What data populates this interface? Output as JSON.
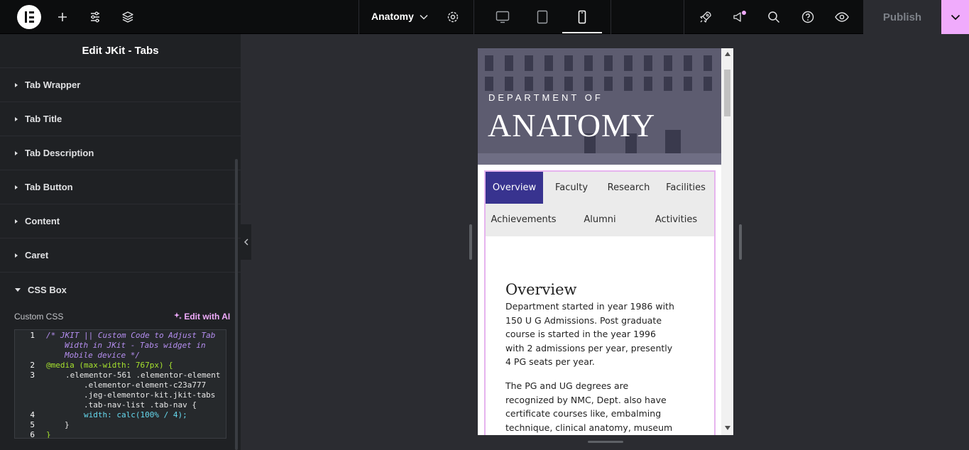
{
  "topbar": {
    "document_title": "Anatomy",
    "publish_label": "Publish",
    "icons": [
      "elementor-logo-icon",
      "add-icon",
      "site-settings-icon",
      "structure-icon",
      "chevron-down-icon",
      "page-settings-icon",
      "desktop-icon",
      "tablet-icon",
      "mobile-icon",
      "rocket-icon",
      "whats-new-icon",
      "search-icon",
      "help-icon",
      "preview-icon"
    ],
    "accent_color": "#f0abfc"
  },
  "panel": {
    "title": "Edit JKit - Tabs",
    "sections": [
      "Tab Wrapper",
      "Tab Title",
      "Tab Description",
      "Tab Button",
      "Content",
      "Caret",
      "CSS Box"
    ],
    "custom_css_label": "Custom CSS",
    "edit_with_ai": "Edit with AI",
    "code_lines": {
      "n1": "1",
      "n2": "2",
      "n3": "3",
      "n4": "4",
      "n5": "5",
      "n6": "6",
      "l1a": "/* JKIT || Custom Code to Adjust Tab",
      "l1b": "Width in JKit - Tabs widget in",
      "l1c": "Mobile device */",
      "l2": "@media (max-width: 767px) {",
      "l3a": ".elementor-561 .elementor-element",
      "l3b": ".elementor-element-c23a777",
      "l3c": ".jeg-elementor-kit.jkit-tabs",
      "l3d": ".tab-nav-list .tab-nav {",
      "l4": "width: calc(100% / 4);",
      "l5": "}",
      "l6": "}"
    }
  },
  "preview": {
    "hero_sub": "DEPARTMENT OF",
    "hero_title": "ANATOMY",
    "tabs": [
      "Overview",
      "Faculty",
      "Research",
      "Facilities",
      "Achievements",
      "Alumni",
      "Activities"
    ],
    "active_tab_color": "#38338f",
    "heading": "Overview",
    "para1": "Department started in year 1986 with 150 U G Admissions. Post graduate course is started in the year 1996 with 2 admissions per year, presently 4 PG seats per year.",
    "para2": "The PG and UG degrees are recognized by NMC, Dept. also have certificate courses like, embalming technique, clinical anatomy, museum"
  }
}
